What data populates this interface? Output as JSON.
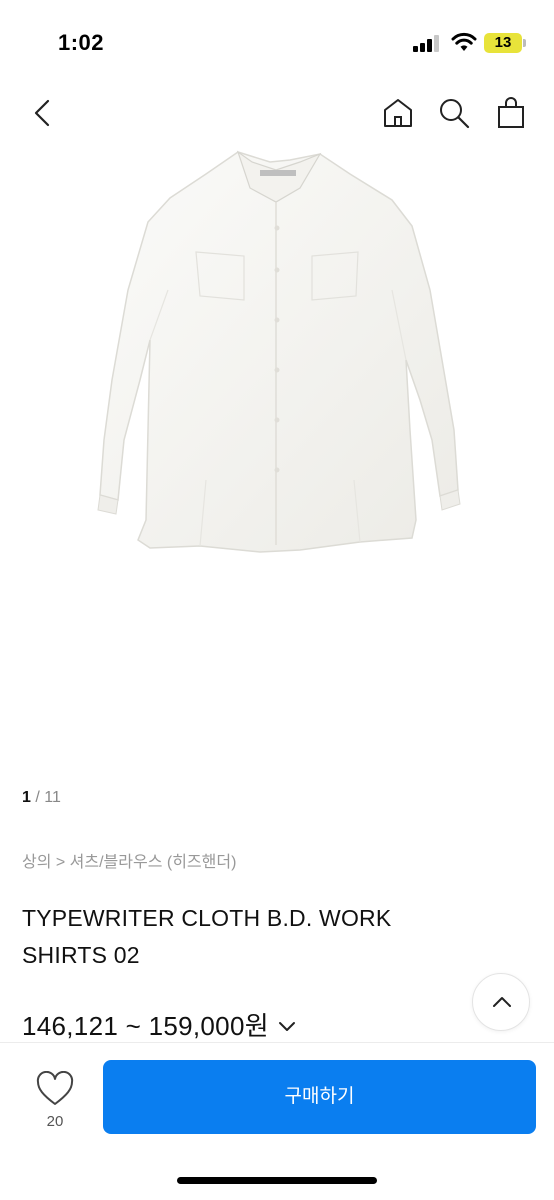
{
  "status_bar": {
    "time": "1:02",
    "battery": "13"
  },
  "nav": {
    "icons": [
      "back-icon",
      "home-icon",
      "search-icon",
      "shopping-bag-icon"
    ]
  },
  "gallery": {
    "current": "1",
    "separator": "/",
    "total": "11"
  },
  "breadcrumb": "상의 > 셔츠/블라우스 (히즈핸더)",
  "product": {
    "title": "TYPEWRITER CLOTH B.D. WORK SHIRTS 02",
    "price": "146,121 ~ 159,000원"
  },
  "bottom_bar": {
    "like_count": "20",
    "buy_label": "구매하기"
  },
  "colors": {
    "accent": "#0a7ef0",
    "battery": "#e8e33a"
  }
}
